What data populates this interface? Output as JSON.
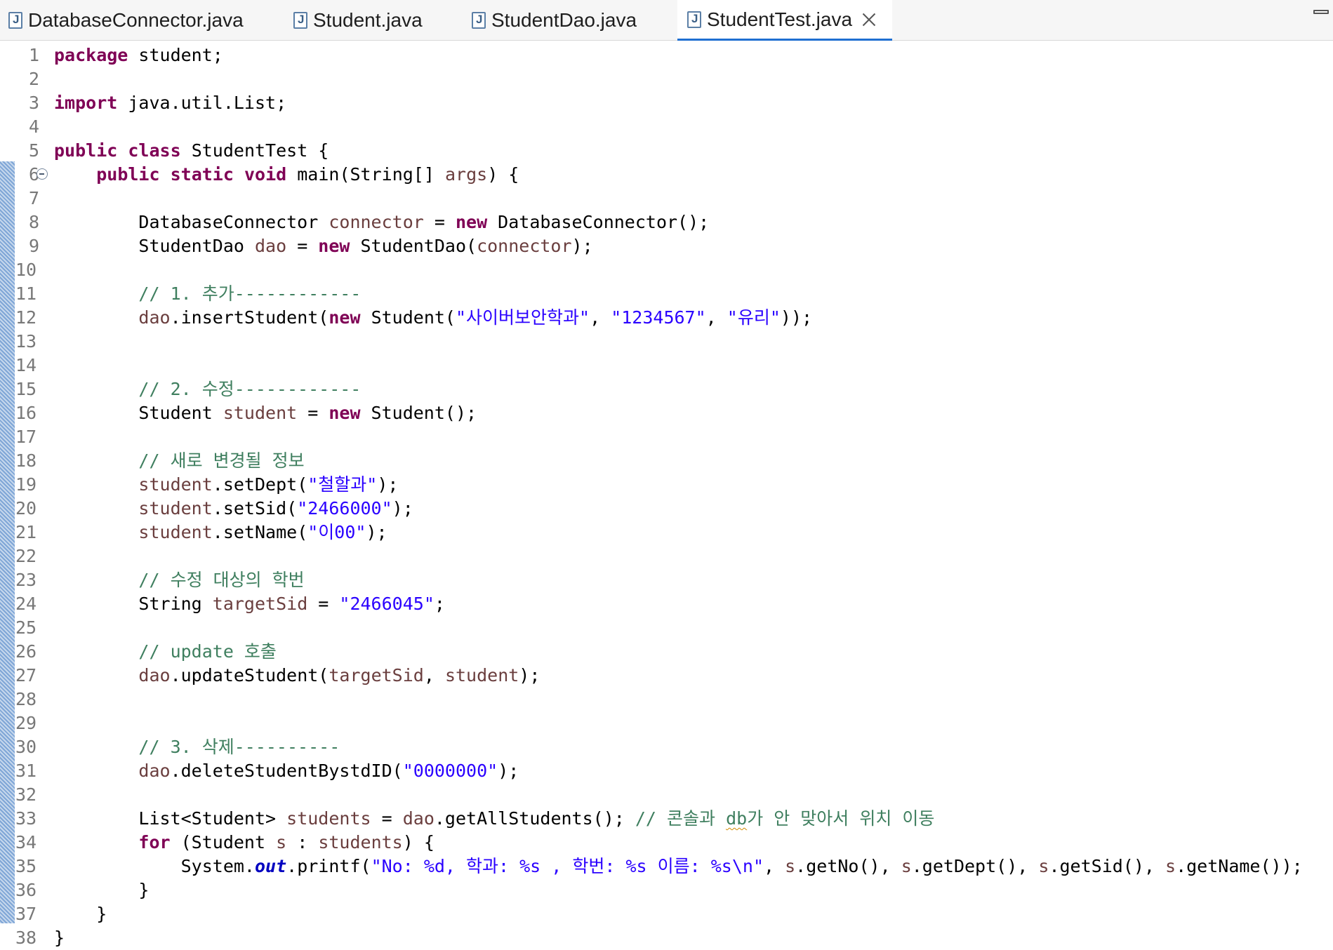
{
  "tabs": [
    {
      "label": "DatabaseConnector.java",
      "active": false
    },
    {
      "label": "Student.java",
      "active": false
    },
    {
      "label": "StudentDao.java",
      "active": false
    },
    {
      "label": "StudentTest.java",
      "active": true
    }
  ],
  "colors": {
    "keyword": "#7f0055",
    "variable": "#6a3e3e",
    "string": "#2a00ff",
    "comment": "#3f7f5f",
    "field": "#0000c0",
    "line_number": "#787878",
    "active_tab_underline": "#1f6fd1"
  },
  "editor": {
    "lines": [
      {
        "no": "1",
        "tokens": [
          [
            "kw",
            "package"
          ],
          [
            "t",
            " student;"
          ]
        ]
      },
      {
        "no": "2",
        "tokens": []
      },
      {
        "no": "3",
        "tokens": [
          [
            "kw",
            "import"
          ],
          [
            "t",
            " java.util.List;"
          ]
        ]
      },
      {
        "no": "4",
        "tokens": []
      },
      {
        "no": "5",
        "tokens": [
          [
            "kw",
            "public"
          ],
          [
            "t",
            " "
          ],
          [
            "kw",
            "class"
          ],
          [
            "t",
            " StudentTest {"
          ]
        ]
      },
      {
        "no": "6",
        "fold": true,
        "tokens": [
          [
            "t",
            "    "
          ],
          [
            "kw",
            "public"
          ],
          [
            "t",
            " "
          ],
          [
            "kw",
            "static"
          ],
          [
            "t",
            " "
          ],
          [
            "kw",
            "void"
          ],
          [
            "t",
            " main(String[] "
          ],
          [
            "var",
            "args"
          ],
          [
            "t",
            ") {"
          ]
        ]
      },
      {
        "no": "7",
        "tokens": []
      },
      {
        "no": "8",
        "tokens": [
          [
            "t",
            "        DatabaseConnector "
          ],
          [
            "var",
            "connector"
          ],
          [
            "t",
            " = "
          ],
          [
            "kw",
            "new"
          ],
          [
            "t",
            " DatabaseConnector();"
          ]
        ]
      },
      {
        "no": "9",
        "tokens": [
          [
            "t",
            "        StudentDao "
          ],
          [
            "var",
            "dao"
          ],
          [
            "t",
            " = "
          ],
          [
            "kw",
            "new"
          ],
          [
            "t",
            " StudentDao("
          ],
          [
            "var",
            "connector"
          ],
          [
            "t",
            ");"
          ]
        ]
      },
      {
        "no": "10",
        "tokens": []
      },
      {
        "no": "11",
        "tokens": [
          [
            "t",
            "        "
          ],
          [
            "cmt",
            "// 1. 추가------------"
          ]
        ]
      },
      {
        "no": "12",
        "tokens": [
          [
            "t",
            "        "
          ],
          [
            "var",
            "dao"
          ],
          [
            "t",
            ".insertStudent("
          ],
          [
            "kw",
            "new"
          ],
          [
            "t",
            " Student("
          ],
          [
            "str",
            "\"사이버보안학과\""
          ],
          [
            "t",
            ", "
          ],
          [
            "str",
            "\"1234567\""
          ],
          [
            "t",
            ", "
          ],
          [
            "str",
            "\"유리\""
          ],
          [
            "t",
            "));"
          ]
        ]
      },
      {
        "no": "13",
        "tokens": []
      },
      {
        "no": "14",
        "tokens": []
      },
      {
        "no": "15",
        "tokens": [
          [
            "t",
            "        "
          ],
          [
            "cmt",
            "// 2. 수정------------"
          ]
        ]
      },
      {
        "no": "16",
        "tokens": [
          [
            "t",
            "        Student "
          ],
          [
            "var",
            "student"
          ],
          [
            "t",
            " = "
          ],
          [
            "kw",
            "new"
          ],
          [
            "t",
            " Student();"
          ]
        ]
      },
      {
        "no": "17",
        "tokens": []
      },
      {
        "no": "18",
        "tokens": [
          [
            "t",
            "        "
          ],
          [
            "cmt",
            "// 새로 변경될 정보"
          ]
        ]
      },
      {
        "no": "19",
        "tokens": [
          [
            "t",
            "        "
          ],
          [
            "var",
            "student"
          ],
          [
            "t",
            ".setDept("
          ],
          [
            "str",
            "\"철할과\""
          ],
          [
            "t",
            ");"
          ]
        ]
      },
      {
        "no": "20",
        "tokens": [
          [
            "t",
            "        "
          ],
          [
            "var",
            "student"
          ],
          [
            "t",
            ".setSid("
          ],
          [
            "str",
            "\"2466000\""
          ],
          [
            "t",
            ");"
          ]
        ]
      },
      {
        "no": "21",
        "tokens": [
          [
            "t",
            "        "
          ],
          [
            "var",
            "student"
          ],
          [
            "t",
            ".setName("
          ],
          [
            "str",
            "\"이00\""
          ],
          [
            "t",
            ");"
          ]
        ]
      },
      {
        "no": "22",
        "tokens": []
      },
      {
        "no": "23",
        "tokens": [
          [
            "t",
            "        "
          ],
          [
            "cmt",
            "// 수정 대상의 학번"
          ]
        ]
      },
      {
        "no": "24",
        "tokens": [
          [
            "t",
            "        String "
          ],
          [
            "var",
            "targetSid"
          ],
          [
            "t",
            " = "
          ],
          [
            "str",
            "\"2466045\""
          ],
          [
            "t",
            ";"
          ]
        ]
      },
      {
        "no": "25",
        "tokens": []
      },
      {
        "no": "26",
        "tokens": [
          [
            "t",
            "        "
          ],
          [
            "cmt",
            "// update 호출"
          ]
        ]
      },
      {
        "no": "27",
        "tokens": [
          [
            "t",
            "        "
          ],
          [
            "var",
            "dao"
          ],
          [
            "t",
            ".updateStudent("
          ],
          [
            "var",
            "targetSid"
          ],
          [
            "t",
            ", "
          ],
          [
            "var",
            "student"
          ],
          [
            "t",
            ");"
          ]
        ]
      },
      {
        "no": "28",
        "tokens": []
      },
      {
        "no": "29",
        "tokens": []
      },
      {
        "no": "30",
        "tokens": [
          [
            "t",
            "        "
          ],
          [
            "cmt",
            "// 3. 삭제----------"
          ]
        ]
      },
      {
        "no": "31",
        "tokens": [
          [
            "t",
            "        "
          ],
          [
            "var",
            "dao"
          ],
          [
            "t",
            ".deleteStudentBystdID("
          ],
          [
            "str",
            "\"0000000\""
          ],
          [
            "t",
            ");"
          ]
        ]
      },
      {
        "no": "32",
        "tokens": []
      },
      {
        "no": "33",
        "tokens": [
          [
            "t",
            "        List<Student> "
          ],
          [
            "var",
            "students"
          ],
          [
            "t",
            " = "
          ],
          [
            "var",
            "dao"
          ],
          [
            "t",
            ".getAllStudents(); "
          ],
          [
            "cmt",
            "// 콘솔과 "
          ],
          [
            "cmtsq",
            "db"
          ],
          [
            "cmt",
            "가 안 맞아서 위치 이동"
          ]
        ]
      },
      {
        "no": "34",
        "tokens": [
          [
            "t",
            "        "
          ],
          [
            "kw",
            "for"
          ],
          [
            "t",
            " (Student "
          ],
          [
            "var",
            "s"
          ],
          [
            "t",
            " : "
          ],
          [
            "var",
            "students"
          ],
          [
            "t",
            ") {"
          ]
        ]
      },
      {
        "no": "35",
        "tokens": [
          [
            "t",
            "            System."
          ],
          [
            "fld",
            "out"
          ],
          [
            "t",
            ".printf("
          ],
          [
            "str",
            "\"No: %d, 학과: %s , 학번: %s 이름: %s\\n\""
          ],
          [
            "t",
            ", "
          ],
          [
            "var",
            "s"
          ],
          [
            "t",
            ".getNo(), "
          ],
          [
            "var",
            "s"
          ],
          [
            "t",
            ".getDept(), "
          ],
          [
            "var",
            "s"
          ],
          [
            "t",
            ".getSid(), "
          ],
          [
            "var",
            "s"
          ],
          [
            "t",
            ".getName());"
          ]
        ]
      },
      {
        "no": "36",
        "tokens": [
          [
            "t",
            "        }"
          ]
        ]
      },
      {
        "no": "37",
        "tokens": [
          [
            "t",
            "    }"
          ]
        ]
      },
      {
        "no": "38",
        "tokens": [
          [
            "t",
            "}"
          ]
        ]
      }
    ]
  }
}
